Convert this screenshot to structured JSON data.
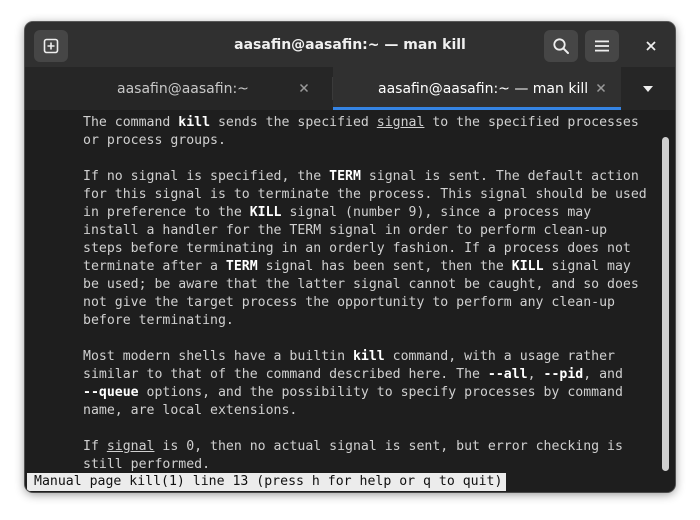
{
  "window": {
    "title": "aasafin@aasafin:~ — man kill"
  },
  "header": {
    "new_tab_icon": "new-tab-icon",
    "search_icon": "search-icon",
    "menu_icon": "hamburger-menu-icon",
    "close_icon": "close-icon"
  },
  "tabs": [
    {
      "label": "aasafin@aasafin:~",
      "active": false
    },
    {
      "label": "aasafin@aasafin:~ — man kill",
      "active": true
    }
  ],
  "colors": {
    "accent": "#3584e4",
    "terminal_bg": "#1e1e1e",
    "titlebar_bg": "#303030",
    "text": "#d0d0d0"
  },
  "terminal": {
    "lines": [
      [
        {
          "t": "The command "
        },
        {
          "t": "kill",
          "s": "b"
        },
        {
          "t": " sends the specified "
        },
        {
          "t": "signal",
          "s": "u"
        },
        {
          "t": " to the specified processes"
        }
      ],
      [
        {
          "t": "or process groups."
        }
      ],
      [],
      [
        {
          "t": "If no signal is specified, the "
        },
        {
          "t": "TERM",
          "s": "b"
        },
        {
          "t": " signal is sent. The default action"
        }
      ],
      [
        {
          "t": "for this signal is to terminate the process. This signal should be used"
        }
      ],
      [
        {
          "t": "in preference to the "
        },
        {
          "t": "KILL",
          "s": "b"
        },
        {
          "t": " signal (number 9), since a process may"
        }
      ],
      [
        {
          "t": "install a handler for the TERM signal in order to perform clean-up"
        }
      ],
      [
        {
          "t": "steps before terminating in an orderly fashion. If a process does not"
        }
      ],
      [
        {
          "t": "terminate after a "
        },
        {
          "t": "TERM",
          "s": "b"
        },
        {
          "t": " signal has been sent, then the "
        },
        {
          "t": "KILL",
          "s": "b"
        },
        {
          "t": " signal may"
        }
      ],
      [
        {
          "t": "be used; be aware that the latter signal cannot be caught, and so does"
        }
      ],
      [
        {
          "t": "not give the target process the opportunity to perform any clean-up"
        }
      ],
      [
        {
          "t": "before terminating."
        }
      ],
      [],
      [
        {
          "t": "Most modern shells have a builtin "
        },
        {
          "t": "kill",
          "s": "b"
        },
        {
          "t": " command, with a usage rather"
        }
      ],
      [
        {
          "t": "similar to that of the command described here. The "
        },
        {
          "t": "--all",
          "s": "b"
        },
        {
          "t": ", "
        },
        {
          "t": "--pid",
          "s": "b"
        },
        {
          "t": ", and"
        }
      ],
      [
        {
          "t": "--queue",
          "s": "b"
        },
        {
          "t": " options, and the possibility to specify processes by command"
        }
      ],
      [
        {
          "t": "name, are local extensions."
        }
      ],
      [],
      [
        {
          "t": "If "
        },
        {
          "t": "signal",
          "s": "u"
        },
        {
          "t": " is 0, then no actual signal is sent, but error checking is"
        }
      ],
      [
        {
          "t": "still performed."
        }
      ]
    ],
    "status_line": "Manual page kill(1) line 13 (press h for help or q to quit)"
  }
}
